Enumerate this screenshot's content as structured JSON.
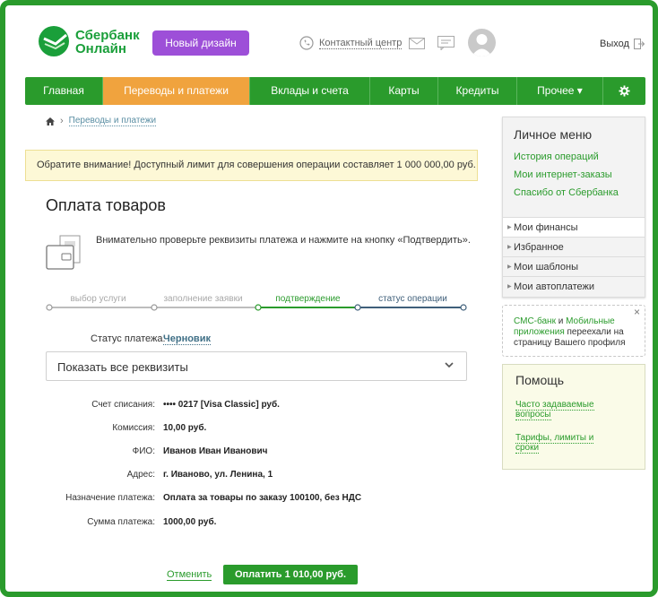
{
  "header": {
    "logo_line1": "Сбербанк",
    "logo_line2": "Онлайн",
    "new_design": "Новый дизайн",
    "contact": "Контактный центр",
    "exit": "Выход"
  },
  "nav": {
    "items": [
      "Главная",
      "Переводы и платежи",
      "Вклады и счета",
      "Карты",
      "Кредиты",
      "Прочее ▾"
    ],
    "active": "Переводы и платежи",
    "settings_icon": "gear-icon"
  },
  "breadcrumb": {
    "current": "Переводы и платежи"
  },
  "notice": "Обратите внимание! Доступный лимит для совершения операции составляет 1 000 000,00 руб.",
  "page": {
    "title": "Оплата товаров",
    "instruction": "Внимательно проверьте реквизиты платежа и нажмите на кнопку «Подтвердить»."
  },
  "steps": [
    "выбор услуги",
    "заполнение заявки",
    "подтверждение",
    "статус операции"
  ],
  "status": {
    "label": "Статус платежа:",
    "value": "Черновик"
  },
  "details_toggle": "Показать все реквизиты",
  "details": [
    {
      "label": "Счет списания:",
      "value": "•••• 0217  [Visa Classic]  руб."
    },
    {
      "label": "Комиссия:",
      "value": "10,00 руб."
    },
    {
      "label": "ФИО:",
      "value": "Иванов Иван Иванович"
    },
    {
      "label": "Адрес:",
      "value": "г. Иваново, ул. Ленина, 1"
    },
    {
      "label": "Назначение платежа:",
      "value": "Оплата за товары по заказу 100100, без НДС"
    },
    {
      "label": "Сумма платежа:",
      "value": "1000,00 руб."
    }
  ],
  "actions": {
    "cancel": "Отменить",
    "pay": "Оплатить 1 010,00 руб."
  },
  "personal_menu": {
    "title": "Личное меню",
    "links": [
      "История операций",
      "Мои интернет-заказы",
      "Спасибо от Сбербанка"
    ],
    "sections": [
      "Мои финансы",
      "Избранное",
      "Мои шаблоны",
      "Мои автоплатежи"
    ]
  },
  "sms_note": {
    "link1": "СМС-банк",
    "and": " и ",
    "link2": "Мобильные приложения",
    "text": " переехали на страницу Вашего профиля"
  },
  "help": {
    "title": "Помощь",
    "link1": "Часто задаваемые вопросы",
    "link2": "Тарифы, лимиты и сроки"
  },
  "colors": {
    "brand_green": "#2a9b2c",
    "active_tab": "#f0a33e",
    "new_design_button": "#9d4fd8",
    "notice_bg": "#fdf8d6"
  }
}
